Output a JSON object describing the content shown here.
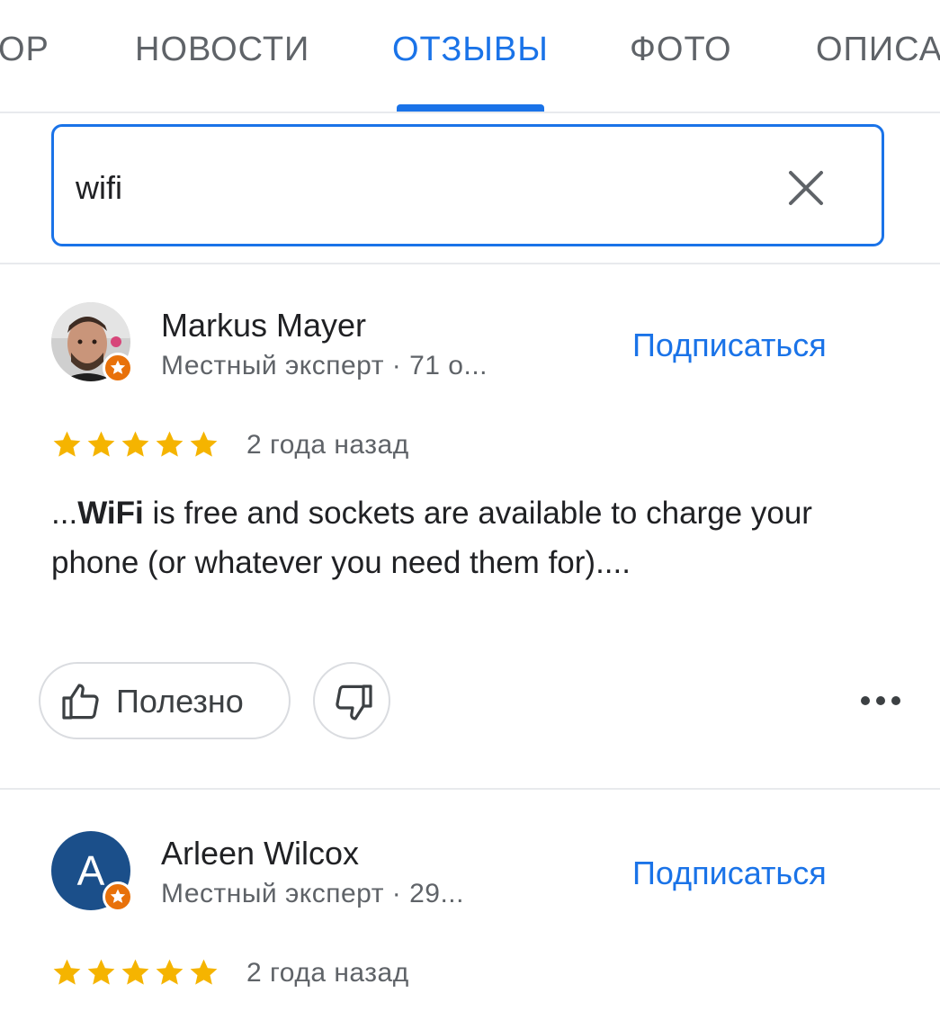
{
  "tabs": [
    {
      "label": "ОР",
      "active": false
    },
    {
      "label": "НОВОСТИ",
      "active": false
    },
    {
      "label": "ОТЗЫВЫ",
      "active": true
    },
    {
      "label": "ФОТО",
      "active": false
    },
    {
      "label": "ОПИСА",
      "active": false
    }
  ],
  "search": {
    "value": "wifi"
  },
  "reviews": [
    {
      "author": "Markus Mayer",
      "meta": "Местный эксперт · 71 о...",
      "follow_label": "Подписаться",
      "rating": 5,
      "date": "2 года назад",
      "text_prefix": "...",
      "text_highlight": "WiFi",
      "text_rest": " is free and sockets are available to charge your phone (or whatever you need them for)....",
      "helpful_label": "Полезно"
    },
    {
      "author": "Arleen Wilcox",
      "avatar_letter": "A",
      "meta": "Местный эксперт · 29...",
      "follow_label": "Подписаться",
      "rating": 5,
      "date": "2 года назад"
    }
  ],
  "colors": {
    "accent": "#1a73e8",
    "star": "#f5b400",
    "badge": "#e8710a",
    "avatar_bg": "#1b4f8a"
  }
}
